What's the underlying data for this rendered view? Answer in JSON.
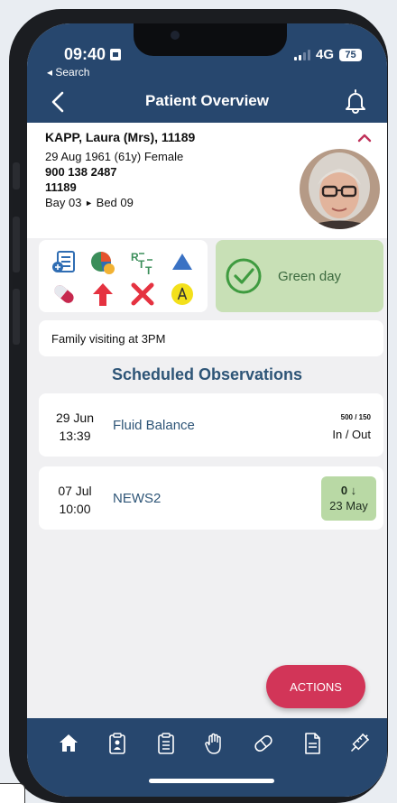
{
  "status_bar": {
    "time": "09:40",
    "back_app": "◂ Search",
    "network": "4G",
    "battery": "75"
  },
  "header": {
    "title": "Patient Overview"
  },
  "patient": {
    "name": "KAPP, Laura (Mrs), 11189",
    "dob_line": "29 Aug 1961 (61y) Female",
    "nhs_number": "900 138 2487",
    "hospital_number": "11189",
    "bay": "Bay 03",
    "bay_arrow": "►",
    "bed": "Bed 09"
  },
  "status_panel": {
    "icons": [
      "clinical-chart-icon",
      "pie-chart-icon",
      "rtt-icon",
      "blue-triangle-icon",
      "capsule-icon",
      "red-up-arrow-icon",
      "red-cross-icon",
      "yellow-a-badge-icon"
    ],
    "green_day_label": "Green day",
    "green_day_color": "#c8e0b6"
  },
  "note": {
    "text": "Family visiting at 3PM"
  },
  "observations": {
    "title": "Scheduled Observations",
    "items": [
      {
        "date": "29 Jun",
        "time": "13:39",
        "name": "Fluid Balance",
        "value_top": "500 / 150",
        "value_bottom": "In / Out"
      },
      {
        "date": "07 Jul",
        "time": "10:00",
        "name": "NEWS2",
        "score": "0 ↓",
        "score_date": "23 May"
      }
    ]
  },
  "fab": {
    "label": "ACTIONS",
    "color": "#d23558"
  },
  "tabbar": {
    "items": [
      "home-icon",
      "clipboard-person-icon",
      "clipboard-list-icon",
      "hand-icon",
      "pill-icon",
      "document-icon",
      "syringe-icon"
    ]
  },
  "colors": {
    "header": "#27476e",
    "accent_text": "#2e5577",
    "caret": "#c0325a"
  }
}
